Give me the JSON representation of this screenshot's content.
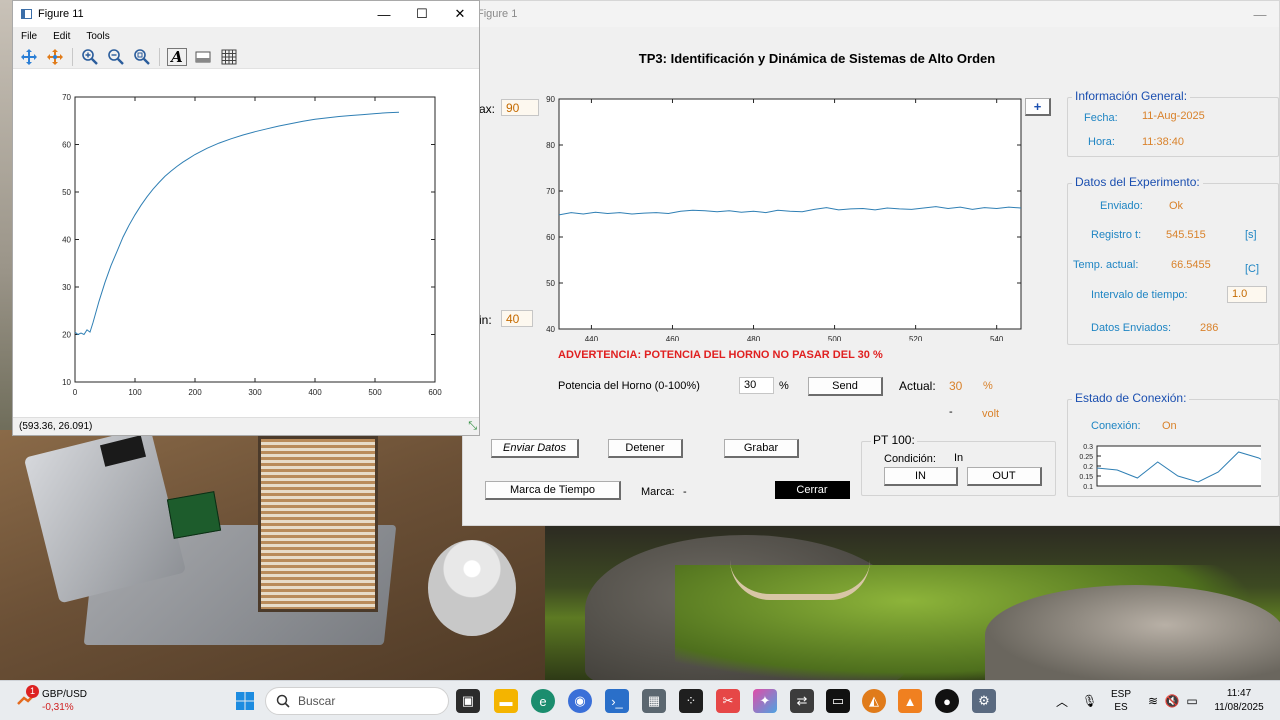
{
  "figure1": {
    "window_title": "Figure 1",
    "main_title": "TP3: Identificación y Dinámica de Sistemas de Alto Orden",
    "ymax_label": "ax:",
    "ymax_value": "90",
    "ymin_label": "in:",
    "ymin_value": "40",
    "plus_button": "+",
    "warning": "ADVERTENCIA: POTENCIA DEL HORNO NO PASAR DEL 30 %",
    "power_label": "Potencia del Horno (0-100%)",
    "power_value": "30",
    "power_unit": "%",
    "send_button": "Send",
    "actual_label": "Actual:",
    "actual_value": "30",
    "actual_unit": "%",
    "dash": "-",
    "volt_label": "volt",
    "buttons": {
      "enviar": "Enviar Datos",
      "detener": "Detener",
      "grabar": "Grabar",
      "marca_tiempo": "Marca de Tiempo",
      "cerrar": "Cerrar"
    },
    "marca_label": "Marca:",
    "marca_value": "-",
    "pt100": {
      "title": "PT 100:",
      "condicion_label": "Condición:",
      "condicion_value": "In",
      "in_button": "IN",
      "out_button": "OUT"
    },
    "info_general": {
      "title": "Información General:",
      "fecha_label": "Fecha:",
      "fecha_value": "11-Aug-2025",
      "hora_label": "Hora:",
      "hora_value": "11:38:40"
    },
    "datos_experimento": {
      "title": "Datos del Experimento:",
      "enviado_label": "Enviado:",
      "enviado_value": "Ok",
      "registro_label": "Registro t:",
      "registro_value": "545.515",
      "registro_unit": "[s]",
      "temp_label": "Temp. actual:",
      "temp_value": "66.5455",
      "temp_unit": "[C]",
      "intervalo_label": "Intervalo de tiempo:",
      "intervalo_value": "1.0",
      "datos_enviados_label": "Datos Enviados:",
      "datos_enviados_value": "286"
    },
    "estado_conexion": {
      "title": "Estado de Conexión:",
      "conexion_label": "Conexión:",
      "conexion_value": "On"
    }
  },
  "figure11": {
    "window_title": "Figure 11",
    "menu": [
      "File",
      "Edit",
      "Tools"
    ],
    "toolbar_icons": [
      "pan-icon",
      "pan-3d-icon",
      "zoom-in-icon",
      "zoom-out-icon",
      "zoom-reset-icon",
      "text-insert-icon",
      "colorbar-icon",
      "grid-icon"
    ],
    "status_text": "(593.36, 26.091)"
  },
  "taskbar": {
    "ticker_badge": "1",
    "ticker_symbol": "GBP/USD",
    "ticker_change": "-0,31%",
    "search_placeholder": "Buscar",
    "lang_top": "ESP",
    "lang_bottom": "ES",
    "time": "11:47",
    "date": "11/08/2025"
  },
  "chart_data": [
    {
      "type": "line",
      "title": "",
      "xlabel": "",
      "ylabel": "",
      "xlim": [
        0,
        600
      ],
      "ylim": [
        10,
        70
      ],
      "xticks": [
        0,
        100,
        200,
        300,
        400,
        500,
        600
      ],
      "yticks": [
        10,
        20,
        30,
        40,
        50,
        60,
        70
      ],
      "grid": false,
      "series": [
        {
          "color": "#2f7fb4",
          "x": [
            0,
            5,
            10,
            15,
            20,
            25,
            30,
            40,
            50,
            60,
            70,
            80,
            90,
            100,
            110,
            120,
            130,
            140,
            150,
            160,
            170,
            180,
            190,
            200,
            220,
            240,
            260,
            280,
            300,
            320,
            340,
            360,
            380,
            400,
            420,
            440,
            460,
            480,
            500,
            520,
            540
          ],
          "y": [
            20.5,
            20,
            20.3,
            20,
            21,
            20.5,
            22.5,
            27,
            31,
            34.5,
            37.5,
            40.5,
            43,
            45.2,
            47.2,
            49,
            50.6,
            52,
            53.3,
            54.4,
            55.4,
            56.3,
            57.1,
            57.9,
            59.2,
            60.3,
            61.2,
            62,
            62.7,
            63.3,
            63.9,
            64.4,
            64.9,
            65.3,
            65.6,
            65.9,
            66.1,
            66.3,
            66.5,
            66.7,
            66.8
          ]
        }
      ]
    },
    {
      "type": "line",
      "title": "",
      "xlabel": "",
      "ylabel": "",
      "xlim": [
        432,
        546
      ],
      "ylim": [
        40,
        90
      ],
      "xticks": [
        440,
        460,
        480,
        500,
        520,
        540
      ],
      "yticks": [
        40,
        50,
        60,
        70,
        80,
        90
      ],
      "grid": false,
      "series": [
        {
          "color": "#2f7fb4",
          "x": [
            432,
            435,
            438,
            441,
            444,
            447,
            450,
            453,
            456,
            459,
            462,
            465,
            468,
            471,
            474,
            477,
            480,
            483,
            486,
            489,
            492,
            495,
            498,
            501,
            504,
            507,
            510,
            513,
            516,
            519,
            522,
            525,
            528,
            531,
            534,
            537,
            540,
            543,
            546
          ],
          "y": [
            64.8,
            65.3,
            65.0,
            65.4,
            65.1,
            65.3,
            65.0,
            65.2,
            65.3,
            65.1,
            65.6,
            65.8,
            65.7,
            65.5,
            65.7,
            65.4,
            65.6,
            65.3,
            65.8,
            65.6,
            65.5,
            66.0,
            66.4,
            65.9,
            66.1,
            66.2,
            65.9,
            66.3,
            66.1,
            66.0,
            66.3,
            66.6,
            66.2,
            66.5,
            66.0,
            66.4,
            66.2,
            66.5,
            66.3
          ]
        }
      ]
    },
    {
      "type": "line",
      "title": "",
      "xlim": [
        0,
        9
      ],
      "ylim": [
        0.1,
        0.3
      ],
      "yticks": [
        0.1,
        0.15,
        0.2,
        0.25,
        0.3
      ],
      "grid": false,
      "series": [
        {
          "color": "#2f7fb4",
          "x": [
            0,
            1,
            2,
            3,
            4,
            5,
            6,
            7,
            8,
            9
          ],
          "y": [
            0.19,
            0.18,
            0.14,
            0.22,
            0.15,
            0.12,
            0.17,
            0.27,
            0.24,
            0.18
          ]
        }
      ]
    }
  ]
}
